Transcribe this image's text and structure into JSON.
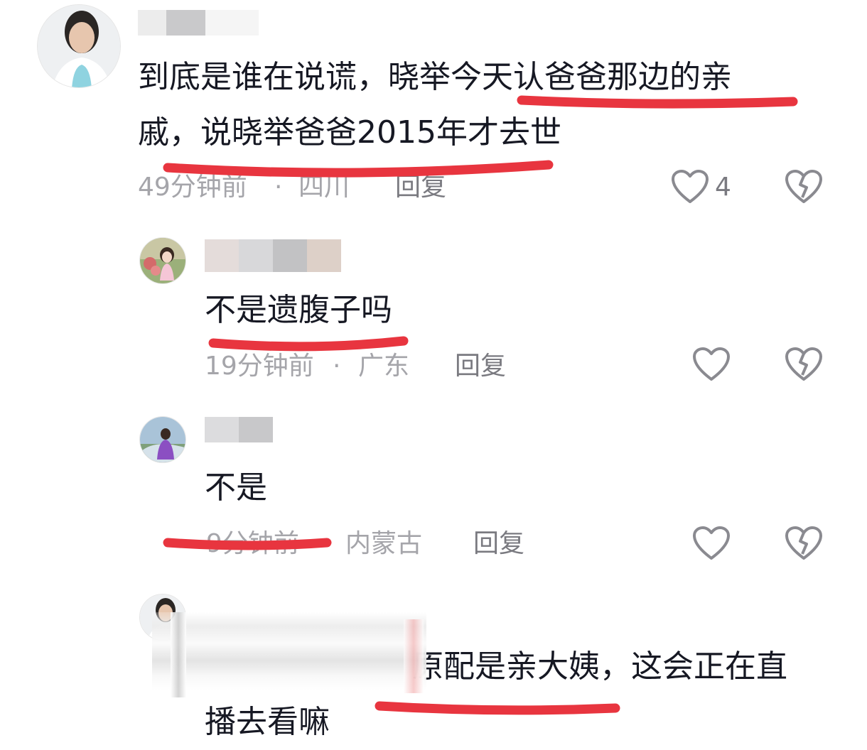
{
  "colors": {
    "underline": "#e8353f",
    "meta": "#a5a5aa",
    "text": "#161823",
    "icon": "#8a8a90"
  },
  "comments": [
    {
      "lines": [
        "到底是谁在说谎，晓举今天认爸爸那边的亲",
        "戚，说晓举爸爸2015年才去世"
      ],
      "time": "49分钟前",
      "sep": "·",
      "location": "四川",
      "reply": "回复",
      "likes": "4",
      "like_icon": "heart-outline-icon",
      "dislike_icon": "broken-heart-icon"
    },
    {
      "lines": [
        "不是遗腹子吗"
      ],
      "time": "19分钟前",
      "sep": "·",
      "location": "广东",
      "reply": "回复",
      "like_icon": "heart-outline-icon",
      "dislike_icon": "broken-heart-icon"
    },
    {
      "lines": [
        "不是"
      ],
      "time": "9分钟前",
      "sep": "·",
      "location": "内蒙古",
      "reply": "回复",
      "like_icon": "heart-outline-icon",
      "dislike_icon": "broken-heart-icon"
    },
    {
      "lines": [
        "原配是亲大姨，这会正在直",
        "播去看嘛"
      ]
    }
  ]
}
